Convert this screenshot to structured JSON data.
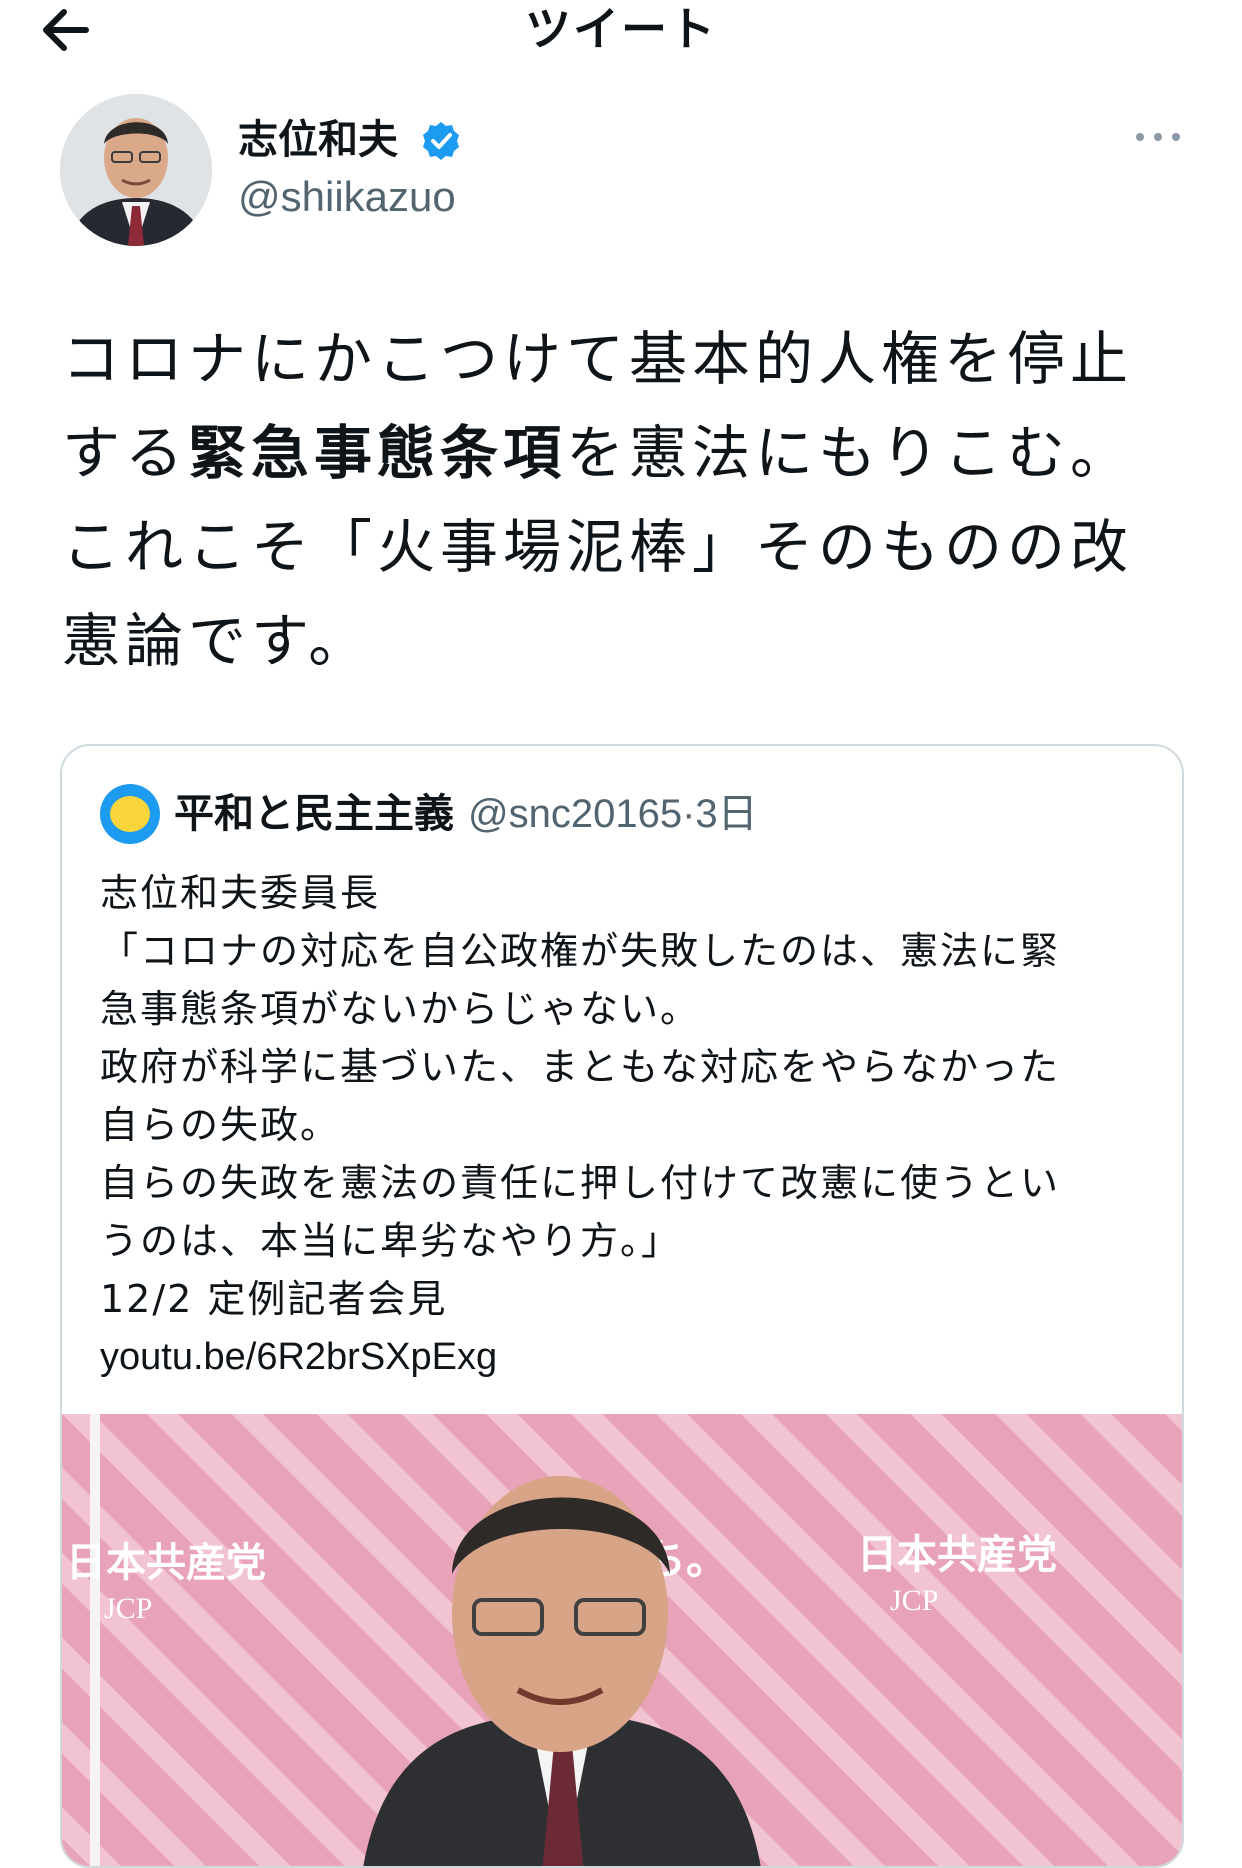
{
  "header": {
    "title": "ツイート"
  },
  "author": {
    "name": "志位和夫",
    "handle": "@shiikazuo"
  },
  "tweet": {
    "text_parts": [
      "コロナにかこつけて基本的人権を停止する",
      "緊急事態条項",
      "を憲法にもりこむ。これこそ「火事場泥棒」そのものの改憲論です。"
    ]
  },
  "quote": {
    "name": "平和と民主主義",
    "handle": "@snc20165",
    "time": "3日",
    "lines": [
      "志位和夫委員長",
      "「コロナの対応を自公政権が失敗したのは、憲法に緊",
      "急事態条項がないからじゃない。",
      "政府が科学に基づいた、まともな対応をやらなかった",
      "自らの失政。",
      "自らの失政を憲法の責任に押し付けて改憲に使うとい",
      "うのは、本当に卑劣なやり方。」",
      "12/2 定例記者会見"
    ],
    "link": "youtu.be/6R2brSXpExg",
    "media_texts": {
      "left_logo": "日本共産党",
      "left_sub": "JCP",
      "center": "のち。",
      "right_logo": "日本共産党",
      "right_sub": "JCP"
    }
  },
  "colors": {
    "verified": "#1d9bf0",
    "text": "#0f1419",
    "secondary": "#536471",
    "border": "#cfd9de",
    "media_bg": "#e8a3b8"
  },
  "icons": {
    "back": "arrow-left-icon",
    "verified": "verified-badge-icon",
    "more": "more-horizontal-icon"
  }
}
